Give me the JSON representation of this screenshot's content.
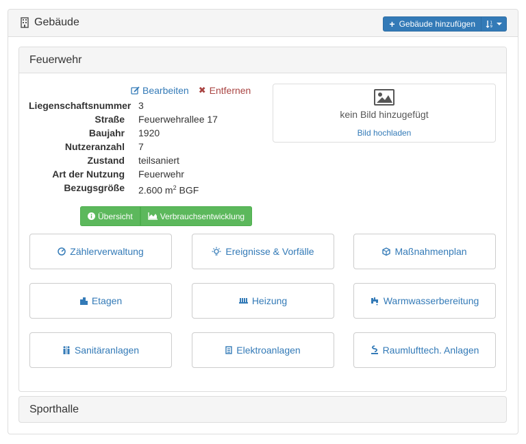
{
  "header": {
    "title": "Gebäude",
    "add_button": "Gebäude hinzufügen",
    "add_icon": "+"
  },
  "building": {
    "name": "Feuerwehr",
    "edit_label": "Bearbeiten",
    "remove_label": "Entfernen",
    "remove_icon": "✖",
    "properties": [
      {
        "key": "Liegenschaftsnummer",
        "value": "3"
      },
      {
        "key": "Straße",
        "value": "Feuerwehrallee 17"
      },
      {
        "key": "Baujahr",
        "value": "1920"
      },
      {
        "key": "Nutzeranzahl",
        "value": "7"
      },
      {
        "key": "Zustand",
        "value": "teilsaniert"
      },
      {
        "key": "Art der Nutzung",
        "value": "Feuerwehr"
      },
      {
        "key": "Bezugsgröße",
        "value_prefix": "2.600 m",
        "value_sup": "2",
        "value_suffix": " BGF"
      }
    ],
    "image": {
      "placeholder": "kein Bild hinzugefügt",
      "upload_label": "Bild hochladen"
    },
    "views": [
      {
        "label": "Übersicht",
        "icon": "info-icon"
      },
      {
        "label": "Verbrauchsentwicklung",
        "icon": "area-chart-icon"
      }
    ],
    "tiles": [
      {
        "label": "Zählerverwaltung",
        "icon": "gauge-icon"
      },
      {
        "label": "Ereignisse & Vorfälle",
        "icon": "lightbulb-icon"
      },
      {
        "label": "Maßnahmenplan",
        "icon": "cube-icon"
      },
      {
        "label": "Etagen",
        "icon": "building-icon"
      },
      {
        "label": "Heizung",
        "icon": "heater-icon"
      },
      {
        "label": "Warmwasserbereitung",
        "icon": "faucet-icon"
      },
      {
        "label": "Sanitäranlagen",
        "icon": "restroom-icon"
      },
      {
        "label": "Elektroanlagen",
        "icon": "fuse-box-icon"
      },
      {
        "label": "Raumlufttech. Anlagen",
        "icon": "ventilation-icon"
      }
    ]
  },
  "collapsed_panels": [
    {
      "name": "Sporthalle"
    }
  ],
  "colors": {
    "primary": "#337ab7",
    "success": "#5cb85c",
    "danger": "#a94442",
    "panel_heading": "#f5f5f5",
    "border": "#dddddd"
  }
}
